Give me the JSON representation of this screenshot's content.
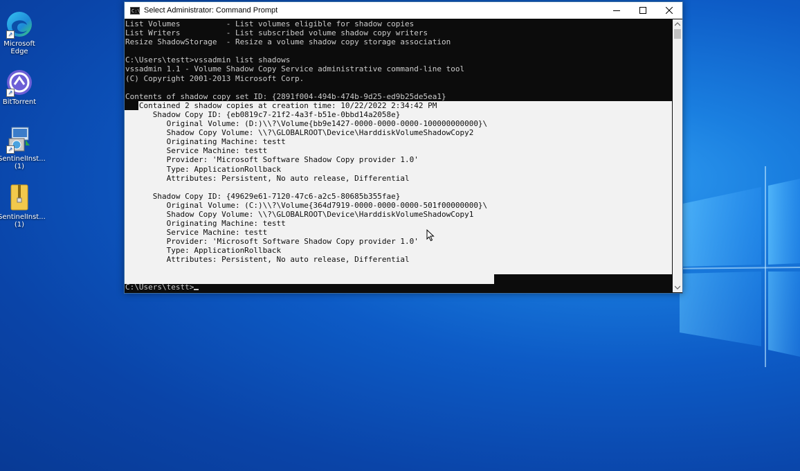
{
  "desktop": {
    "icons": [
      {
        "label_line1": "Microsoft",
        "label_line2": "Edge"
      },
      {
        "label_line1": "BitTorrent",
        "label_line2": ""
      },
      {
        "label_line1": "SentinelInst...",
        "label_line2": "(1)"
      },
      {
        "label_line1": "SentinelInst...",
        "label_line2": "(1)"
      }
    ]
  },
  "window": {
    "title": "Select Administrator: Command Prompt",
    "icon_glyph": "C:\\"
  },
  "console": {
    "lines": [
      "List Volumes          - List volumes eligible for shadow copies",
      "List Writers          - List subscribed volume shadow copy writers",
      "Resize ShadowStorage  - Resize a volume shadow copy storage association",
      "",
      "C:\\Users\\testt>vssadmin list shadows",
      "vssadmin 1.1 - Volume Shadow Copy Service administrative command-line tool",
      "(C) Copyright 2001-2013 Microsoft Corp.",
      "",
      "Contents of shadow copy set ID: {2891f004-494b-474b-9d25-ed9b25de5ea1}",
      "   Contained 2 shadow copies at creation time: 10/22/2022 2:34:42 PM",
      "      Shadow Copy ID: {eb0819c7-21f2-4a3f-b51e-0bbd14a2058e}",
      "         Original Volume: (D:)\\\\?\\Volume{bb9e1427-0000-0000-0000-100000000000}\\",
      "         Shadow Copy Volume: \\\\?\\GLOBALROOT\\Device\\HarddiskVolumeShadowCopy2",
      "         Originating Machine: testt",
      "         Service Machine: testt",
      "         Provider: 'Microsoft Software Shadow Copy provider 1.0'",
      "         Type: ApplicationRollback",
      "         Attributes: Persistent, No auto release, Differential",
      "",
      "      Shadow Copy ID: {49629e61-7120-47c6-a2c5-80685b355fae}",
      "         Original Volume: (C:)\\\\?\\Volume{364d7919-0000-0000-0000-501f00000000}\\",
      "         Shadow Copy Volume: \\\\?\\GLOBALROOT\\Device\\HarddiskVolumeShadowCopy1",
      "         Originating Machine: testt",
      "         Service Machine: testt",
      "         Provider: 'Microsoft Software Shadow Copy provider 1.0'",
      "         Type: ApplicationRollback",
      "         Attributes: Persistent, No auto release, Differential",
      "",
      "",
      "C:\\Users\\testt>"
    ]
  },
  "colors": {
    "console_bg": "#0c0c0c",
    "console_fg": "#cccccc",
    "selection_bg": "#f2f2f2",
    "desktop_blue": "#0d5bc6"
  }
}
